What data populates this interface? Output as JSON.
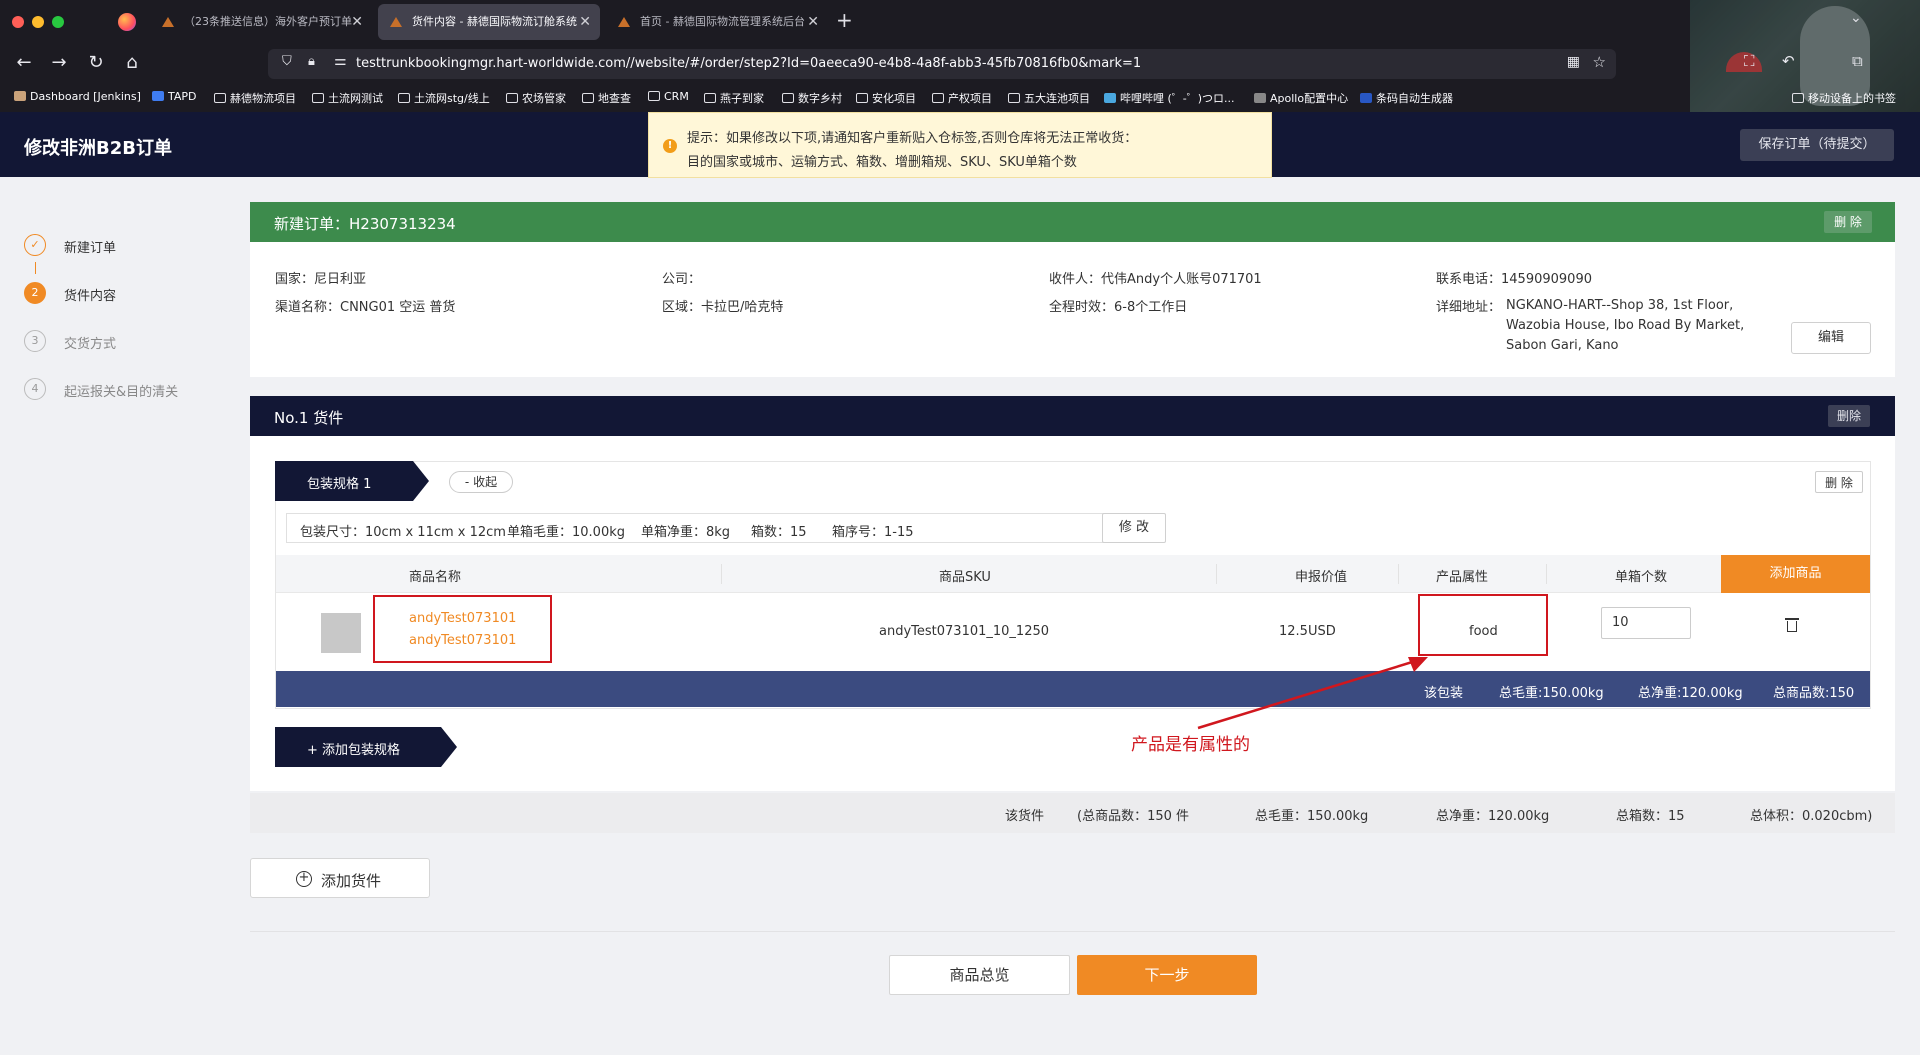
{
  "browser": {
    "tabs": [
      {
        "title": "（23条推送信息）海外客户预订单"
      },
      {
        "title": "货件内容 - 赫德国际物流订舱系统"
      },
      {
        "title": "首页 - 赫德国际物流管理系统后台"
      }
    ],
    "url": "testtrunkbookingmgr.hart-worldwide.com//website/#/order/step2?Id=0aeeca90-e4b8-4a8f-abb3-45fb70816fb0&mark=1",
    "bookmarks": [
      "Dashboard [Jenkins]",
      "TAPD",
      "赫德物流项目",
      "土流网测试",
      "土流网stg/线上",
      "农场管家",
      "地查查",
      "CRM",
      "燕子到家",
      "数字乡村",
      "安化项目",
      "产权项目",
      "五大连池项目",
      "哔哩哔哩 (゜-゜)つロ...",
      "Apollo配置中心",
      "条码自动生成器",
      "移动设备上的书签"
    ]
  },
  "header": {
    "title": "修改非洲B2B订单",
    "save_label": "保存订单（待提交）",
    "notice_line1": "提示：如果修改以下项,请通知客户重新贴入仓标签,否则仓库将无法正常收货：",
    "notice_line2": "目的国家或城市、运输方式、箱数、增删箱规、SKU、SKU单箱个数",
    "notice_icon": "!"
  },
  "steps": [
    {
      "num": "✓",
      "label": "新建订单",
      "state": "done"
    },
    {
      "num": "2",
      "label": "货件内容",
      "state": "current"
    },
    {
      "num": "3",
      "label": "交货方式",
      "state": "todo"
    },
    {
      "num": "4",
      "label": "起运报关&目的清关",
      "state": "todo"
    }
  ],
  "order": {
    "title": "新建订单：H2307313234",
    "delete_label": "删 除",
    "country": "国家：尼日利亚",
    "company": "公司：",
    "receiver": "收件人：代伟Andy个人账号071701",
    "phone": "联系电话：14590909090",
    "channel": "渠道名称：CNNG01 空运 普货",
    "region": "区域：卡拉巴/哈克特",
    "transit": "全程时效：6-8个工作日",
    "address_label": "详细地址：",
    "address_value": "NGKANO-HART--Shop 38, 1st Floor, Wazobia House, Ibo Road By Market, Sabon Gari, Kano",
    "edit_label": "编辑"
  },
  "goods": {
    "title": "No.1 货件",
    "delete_label": "删除",
    "pack": {
      "tab_label": "包装规格 1",
      "collapse_label": "- 收起",
      "delete_label": "删 除",
      "size": "包装尺寸：10cm x 11cm x 12cm",
      "gross": "单箱毛重：10.00kg",
      "net": "单箱净重：8kg",
      "boxes": "箱数：15",
      "box_no": "箱序号：1-15",
      "modify_label": "修 改",
      "columns": [
        "商品名称",
        "商品SKU",
        "申报价值",
        "产品属性",
        "单箱个数"
      ],
      "add_product_label": "添加商品",
      "rows": [
        {
          "name1": "andyTest073101",
          "name2": "andyTest073101",
          "sku": "andyTest073101_10_1250",
          "value": "12.5USD",
          "attribute": "food",
          "qty": "10"
        }
      ],
      "summary": {
        "label": "该包装",
        "gross": "总毛重:150.00kg",
        "net": "总净重:120.00kg",
        "count": "总商品数:150"
      }
    },
    "add_pack_label": "+ 添加包装规格"
  },
  "annotation": "产品是有属性的",
  "totals": {
    "label": "该货件",
    "count": "(总商品数：150 件",
    "gross": "总毛重：150.00kg",
    "net": "总净重：120.00kg",
    "boxes": "总箱数：15",
    "volume": "总体积：0.020cbm)"
  },
  "actions": {
    "add_goods_label": "添加货件",
    "overview_label": "商品总览",
    "next_label": "下一步"
  },
  "colors": {
    "accent": "#f08a24",
    "header_bg": "#121735",
    "order_head": "#3d8b4c",
    "summary_bg": "#3b4b80",
    "annotation": "#d0171e"
  }
}
